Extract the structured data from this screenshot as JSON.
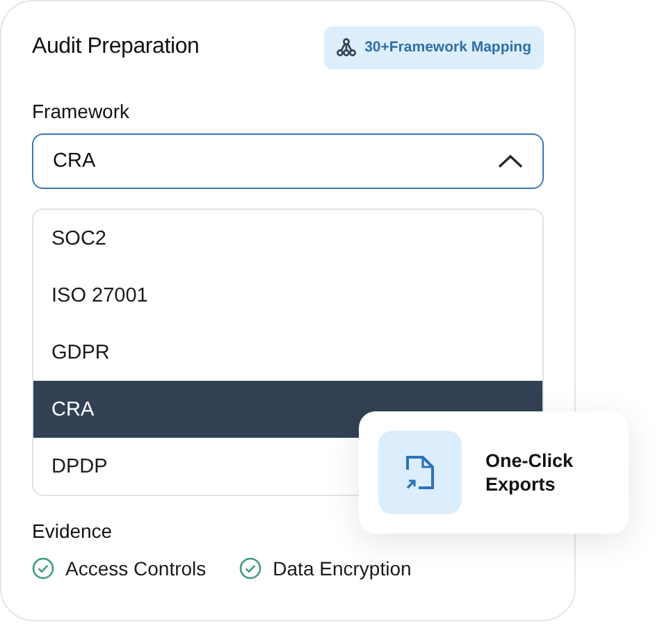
{
  "card": {
    "title": "Audit Preparation",
    "badge": "30+Framework Mapping"
  },
  "framework": {
    "label": "Framework",
    "value": "CRA",
    "expanded": true,
    "options": [
      {
        "label": "SOC2",
        "selected": false
      },
      {
        "label": "ISO 27001",
        "selected": false
      },
      {
        "label": "GDPR",
        "selected": false
      },
      {
        "label": "CRA",
        "selected": true
      },
      {
        "label": "DPDP",
        "selected": false
      }
    ]
  },
  "evidence": {
    "label": "Evidence",
    "items": [
      {
        "label": "Access Controls",
        "checked": true
      },
      {
        "label": "Data Encryption",
        "checked": true
      }
    ]
  },
  "export_card": {
    "label": "One-Click Exports"
  }
}
